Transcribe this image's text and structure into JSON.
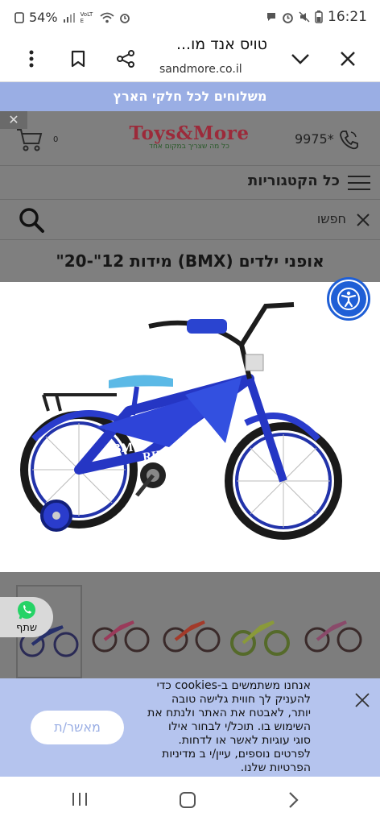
{
  "status_bar": {
    "battery": "54%",
    "time": "16:21",
    "lte": "VoLTE"
  },
  "browser": {
    "page_title": "טויס אנד מו...",
    "url": "sandmore.co.il"
  },
  "shipping_banner": "משלוחים לכל חלקי הארץ",
  "site_header": {
    "logo_text": "Toys&More",
    "logo_tagline": "כל מה שצריך במקום אחד",
    "phone": "9975*",
    "cart_count": "0",
    "close_glyph": "✕"
  },
  "categories_label": "כל הקטגוריות",
  "search": {
    "placeholder": "חפשו"
  },
  "product": {
    "title": "אופני ילדים (BMX) מידות 12\"-20\""
  },
  "whatsapp": {
    "label": "שתף"
  },
  "cookie_banner": {
    "lines": [
      "אנחנו משתמשים ב-cookies כדי",
      "להעניק לך חווית גלישה טובה",
      "יותר, לאבטח את האתר ולנתח את",
      "השימוש בו. תוכל/י לבחור אילו",
      "סוגי עוגיות לאשר או לדחות.",
      "לפרטים נוספים, עיין/י ב מדיניות",
      "הפרטיות שלנו."
    ],
    "accept_label": "מאשר/ת"
  },
  "colors": {
    "shipping_bg": "#9aaee4",
    "overlay_gray": "#7f7f7f",
    "cookie_bg": "#b5c4ee",
    "accessibility_blue": "#1f5fd6",
    "whatsapp_green": "#25d366"
  },
  "icons": [
    "three-dot-menu-icon",
    "bookmark-icon",
    "share-icon",
    "chevron-down-icon",
    "close-icon",
    "cart-icon",
    "phone-icon",
    "hamburger-icon",
    "search-icon",
    "accessibility-icon",
    "whatsapp-icon",
    "recents-icon",
    "home-icon",
    "back-icon"
  ]
}
